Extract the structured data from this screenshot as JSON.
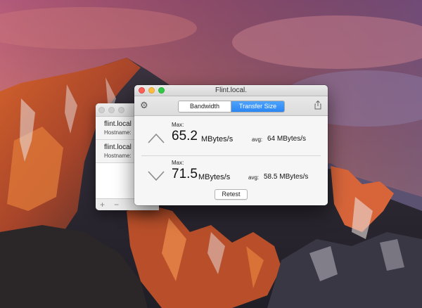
{
  "desktop": {
    "wallpaper": "macOS Sierra mountain"
  },
  "back_window": {
    "items": [
      {
        "name": "flint.local",
        "hostname_label": "Hostname:"
      },
      {
        "name": "flint.local",
        "hostname_label": "Hostname:"
      }
    ],
    "add_label": "+",
    "remove_label": "−"
  },
  "window": {
    "title": "Flint.local.",
    "toolbar": {
      "settings_icon": "gear-icon",
      "tabs": [
        {
          "label": "Bandwidth",
          "selected": false
        },
        {
          "label": "Transfer Size",
          "selected": true
        }
      ],
      "share_icon": "share-icon"
    },
    "upload": {
      "direction_icon": "chevron-up-icon",
      "max_label": "Max:",
      "max_value": "65.2",
      "unit": "MBytes/s",
      "avg_label": "avg:",
      "avg_value": "64 MBytes/s"
    },
    "download": {
      "direction_icon": "chevron-down-icon",
      "max_label": "Max:",
      "max_value": "71.5",
      "unit": "MBytes/s",
      "avg_label": "avg:",
      "avg_value": "58.5 MBytes/s"
    },
    "retest_label": "Retest"
  },
  "colors": {
    "accent": "#2a86f4",
    "close": "#fc605b",
    "minimize": "#fdbc40",
    "zoom": "#34c84a"
  }
}
